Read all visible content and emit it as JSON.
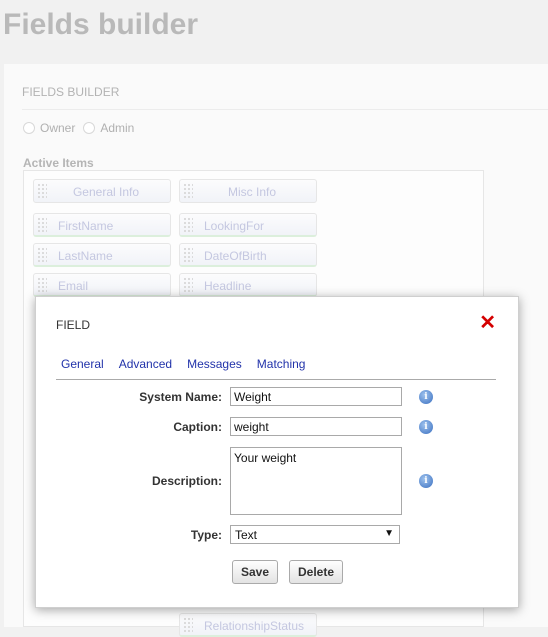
{
  "page": {
    "title": "Fields builder",
    "panel_header": "FIELDS BUILDER",
    "radios": [
      {
        "label": "Owner"
      },
      {
        "label": "Admin"
      }
    ],
    "active_items_label": "Active Items",
    "items": {
      "general_info": "General Info",
      "misc_info": "Misc Info",
      "first_name": "FirstName",
      "looking_for": "LookingFor",
      "last_name": "LastName",
      "date_of_birth": "DateOfBirth",
      "email": "Email",
      "headline": "Headline",
      "relationship_status": "RelationshipStatus"
    }
  },
  "modal": {
    "title": "FIELD",
    "close_symbol": "✕",
    "tabs": [
      "General",
      "Advanced",
      "Messages",
      "Matching"
    ],
    "fields": {
      "system_name_label": "System Name:",
      "system_name_value": "Weight",
      "caption_label": "Caption:",
      "caption_value": "weight",
      "description_label": "Description:",
      "description_value": "Your weight",
      "type_label": "Type:",
      "type_value": "Text"
    },
    "info_glyph": "i",
    "buttons": {
      "save": "Save",
      "delete": "Delete"
    }
  }
}
